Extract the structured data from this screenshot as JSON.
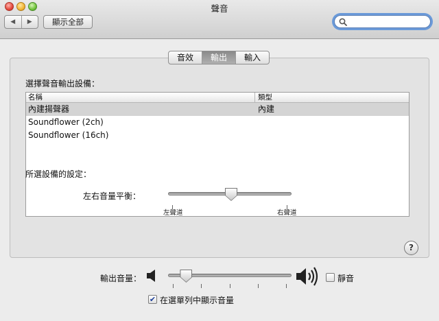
{
  "window": {
    "title": "聲音"
  },
  "toolbar": {
    "back_icon": "◀",
    "forward_icon": "▶",
    "show_all_label": "顯示全部",
    "search_value": "",
    "search_placeholder": ""
  },
  "tabs": [
    {
      "label": "音效",
      "active": false
    },
    {
      "label": "輸出",
      "active": true
    },
    {
      "label": "輸入",
      "active": false
    }
  ],
  "output": {
    "select_device_label": "選擇聲音輸出設備：",
    "columns": {
      "name": "名稱",
      "type": "類型"
    },
    "devices": [
      {
        "name": "內建揚聲器",
        "type": "內建",
        "selected": true
      },
      {
        "name": "Soundflower (2ch)",
        "type": "",
        "selected": false
      },
      {
        "name": "Soundflower (16ch)",
        "type": "",
        "selected": false
      }
    ],
    "settings_label": "所選設備的設定：",
    "balance": {
      "label": "左右音量平衡：",
      "left_label": "左聲道",
      "right_label": "右聲道",
      "value": 0.5
    },
    "help_label": "?"
  },
  "volume": {
    "label": "輸出音量：",
    "value": 0.1,
    "mute_label": "靜音",
    "mute_checked": false,
    "menu_checkbox_label": "在選單列中顯示音量",
    "menu_checked": true,
    "check_glyph": "✔"
  },
  "colors": {
    "search_focus": "#6b9ad9",
    "selected_row": "#d4d4d4",
    "active_tab": "#8a8a8a"
  }
}
